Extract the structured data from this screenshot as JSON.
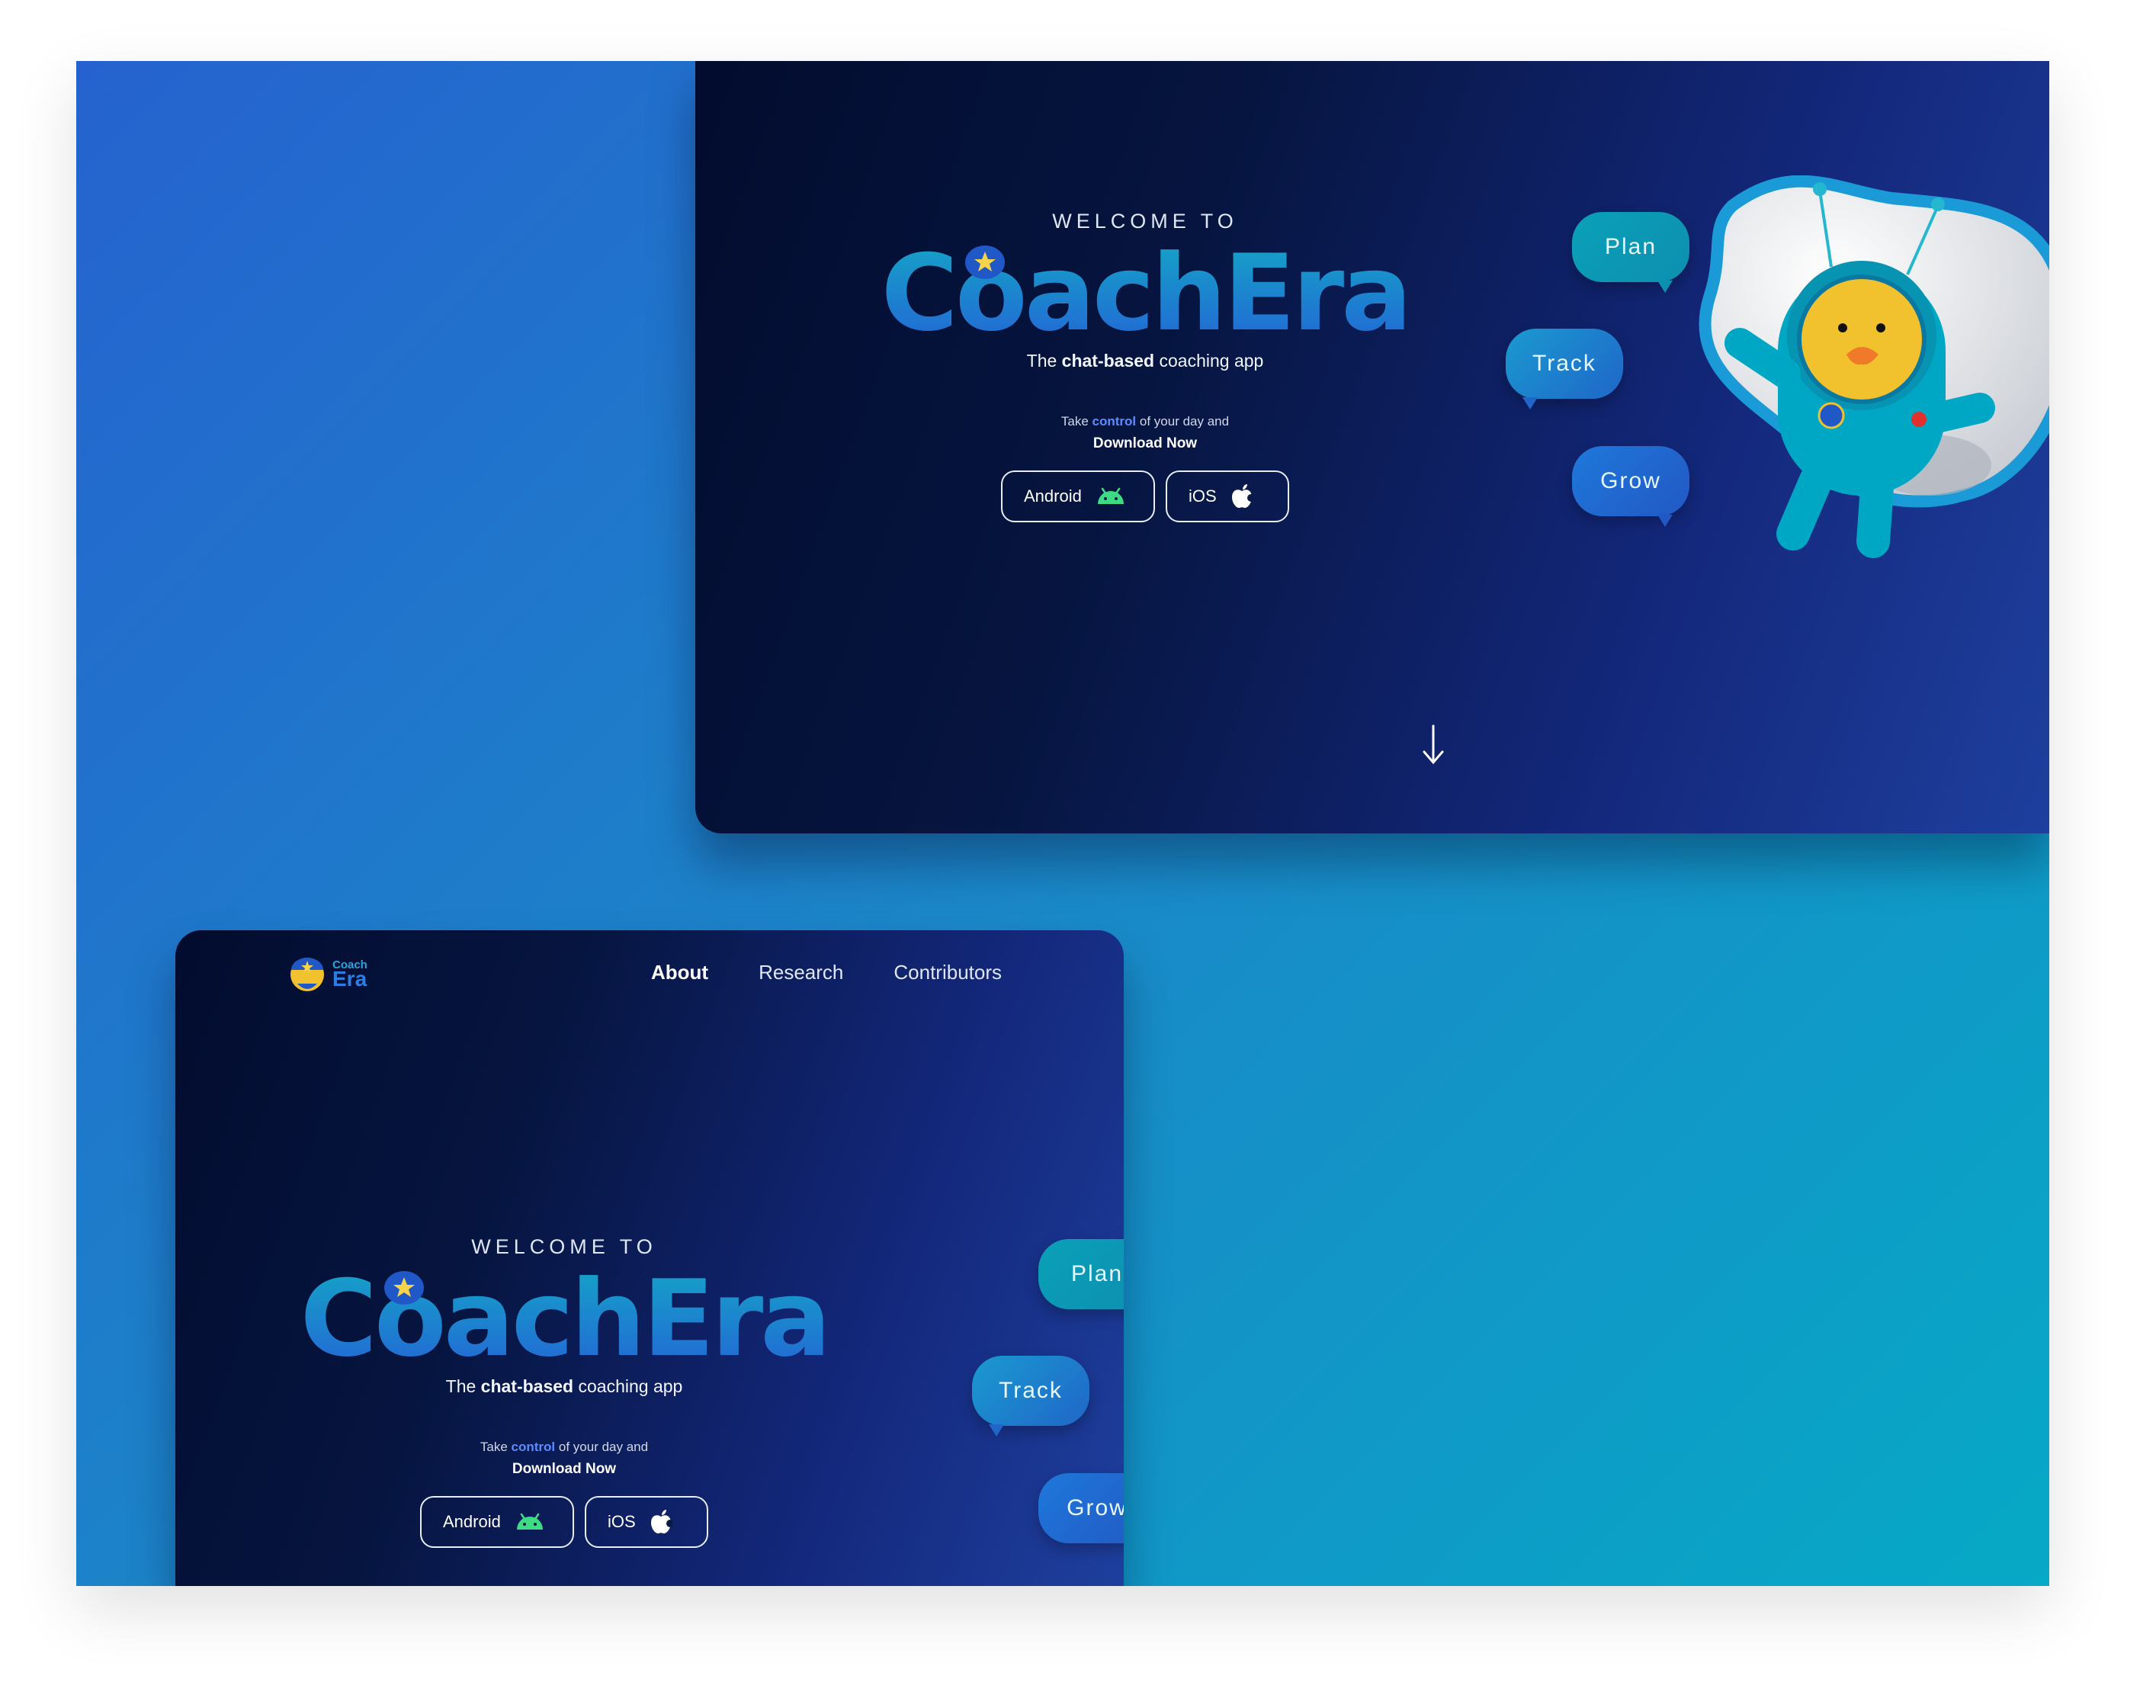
{
  "hero": {
    "welcome": "WELCOME TO",
    "brand": "CoachEra",
    "tagline_pre": "The ",
    "tagline_bold": "chat-based",
    "tagline_post": " coaching app",
    "cta_pre": "Take ",
    "cta_accent": "control",
    "cta_post": " of your day and",
    "cta_bold": "Download Now",
    "android_label": "Android",
    "ios_label": "iOS"
  },
  "bubbles": {
    "plan": "Plan",
    "track": "Track",
    "grow": "Grow"
  },
  "nav": {
    "logo_line1": "Coach",
    "logo_line2": "Era",
    "items": [
      "About",
      "Research",
      "Contributors"
    ],
    "active": "About"
  },
  "colors": {
    "canvas_start": "#2562cf",
    "canvas_end": "#06a9c6",
    "panel_dark": "#020c2e",
    "panel_light": "#1e3f9e",
    "brand_gradient_start": "#13a6c4",
    "brand_gradient_end": "#2463d6",
    "android_green": "#3ddc84",
    "mascot_body": "#00a7c4",
    "mascot_face": "#f2c12e",
    "star": "#f5d34a"
  },
  "icons": {
    "android": "android-icon",
    "apple": "apple-icon",
    "scroll": "arrow-down-icon",
    "logo": "coachera-logo-icon"
  }
}
